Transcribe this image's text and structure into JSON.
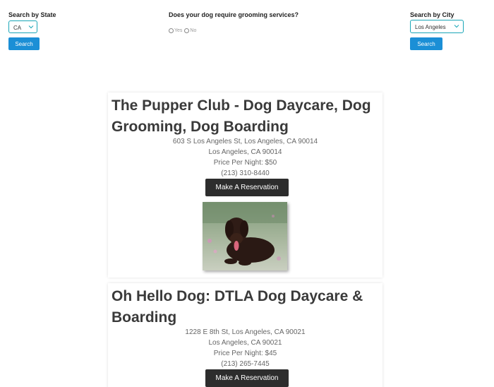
{
  "filters": {
    "state": {
      "label": "Search by State",
      "selected": "CA",
      "button": "Search"
    },
    "grooming": {
      "question": "Does your dog require grooming services?",
      "options": [
        "Yes",
        "No"
      ]
    },
    "city": {
      "label": "Search by City",
      "selected": "Los Angeles",
      "button": "Search"
    }
  },
  "listings": [
    {
      "title": "The Pupper Club - Dog Daycare, Dog Grooming, Dog Boarding",
      "address": "603 S Los Angeles St, Los Angeles, CA 90014",
      "city_line": "Los Angeles, CA 90014",
      "price": "Price Per Night: $50",
      "phone": "(213) 310-8440",
      "button": "Make A Reservation"
    },
    {
      "title": "Oh Hello Dog: DTLA Dog Daycare & Boarding",
      "address": "1228 E 8th St, Los Angeles, CA 90021",
      "city_line": "Los Angeles, CA 90021",
      "price": "Price Per Night: $45",
      "phone": "(213) 265-7445",
      "button": "Make A Reservation"
    }
  ],
  "colors": {
    "select_border": "#1aa6b7",
    "search_button": "#1b8fd6",
    "reserve_button": "#2d2d2d"
  }
}
